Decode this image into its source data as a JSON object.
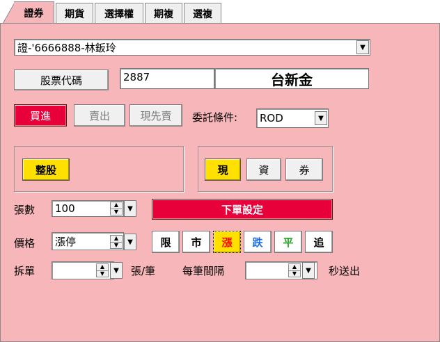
{
  "tabs": [
    {
      "label": "證券",
      "active": true
    },
    {
      "label": "期貨",
      "active": false
    },
    {
      "label": "選擇權",
      "active": false
    },
    {
      "label": "期複",
      "active": false
    },
    {
      "label": "選複",
      "active": false
    }
  ],
  "account": {
    "value": "證-'6666888-林鈑玲"
  },
  "stock": {
    "code_button": "股票代碼",
    "code": "2887",
    "name": "台新金"
  },
  "side": {
    "buy": "買進",
    "sell": "賣出",
    "short_sell": "現先賣"
  },
  "condition": {
    "label": "委託條件:",
    "value": "ROD"
  },
  "lot": {
    "whole": "整股"
  },
  "credit": {
    "cash": "現",
    "margin": "資",
    "short": "券"
  },
  "quantity": {
    "label": "張數",
    "value": "100"
  },
  "order_settings": {
    "label": "下單設定"
  },
  "price": {
    "label": "價格",
    "value": "漲停",
    "buttons": {
      "limit": "限",
      "market": "市",
      "up": "漲",
      "down": "跌",
      "flat": "平",
      "chase": "追"
    }
  },
  "split": {
    "label": "拆單",
    "value": "",
    "unit": "張/筆",
    "interval_label": "每筆間隔",
    "interval_value": "",
    "interval_unit": "秒送出"
  },
  "colors": {
    "panel_bg": "#f7b6b9",
    "buy_red": "#e8003a",
    "highlight_yellow": "#ffe000",
    "up_red": "#ff0000",
    "down_blue": "#1e6fe0",
    "flat_green": "#20a020"
  }
}
